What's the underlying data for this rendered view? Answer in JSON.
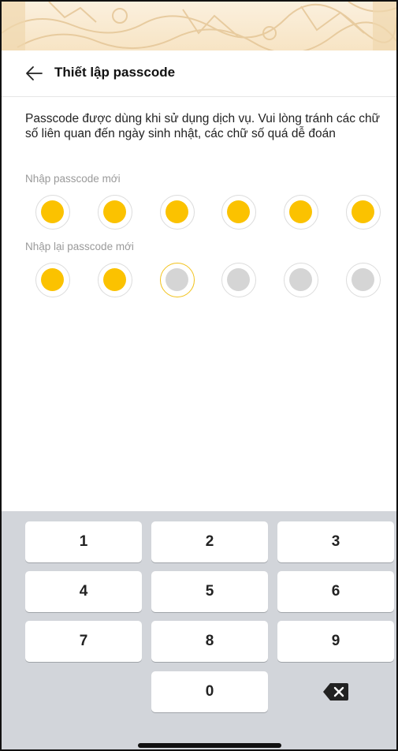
{
  "header": {
    "title": "Thiết lập passcode",
    "back_icon": "arrow-left-icon"
  },
  "description": "Passcode được dùng khi sử dụng dịch vụ. Vui lòng tránh các chữ số liên quan đến ngày sinh nhật, các chữ số quá dễ đoán",
  "new_passcode": {
    "label": "Nhập passcode mới",
    "entered_count": 6,
    "length": 6
  },
  "confirm_passcode": {
    "label": "Nhập lại passcode mới",
    "entered_count": 2,
    "length": 6
  },
  "keypad": {
    "keys": [
      "1",
      "2",
      "3",
      "4",
      "5",
      "6",
      "7",
      "8",
      "9",
      "0"
    ],
    "delete_icon": "backspace-icon"
  },
  "colors": {
    "filled_dot": "#fbc200",
    "empty_dot": "#d5d5d5",
    "keypad_background": "#d2d5da"
  }
}
